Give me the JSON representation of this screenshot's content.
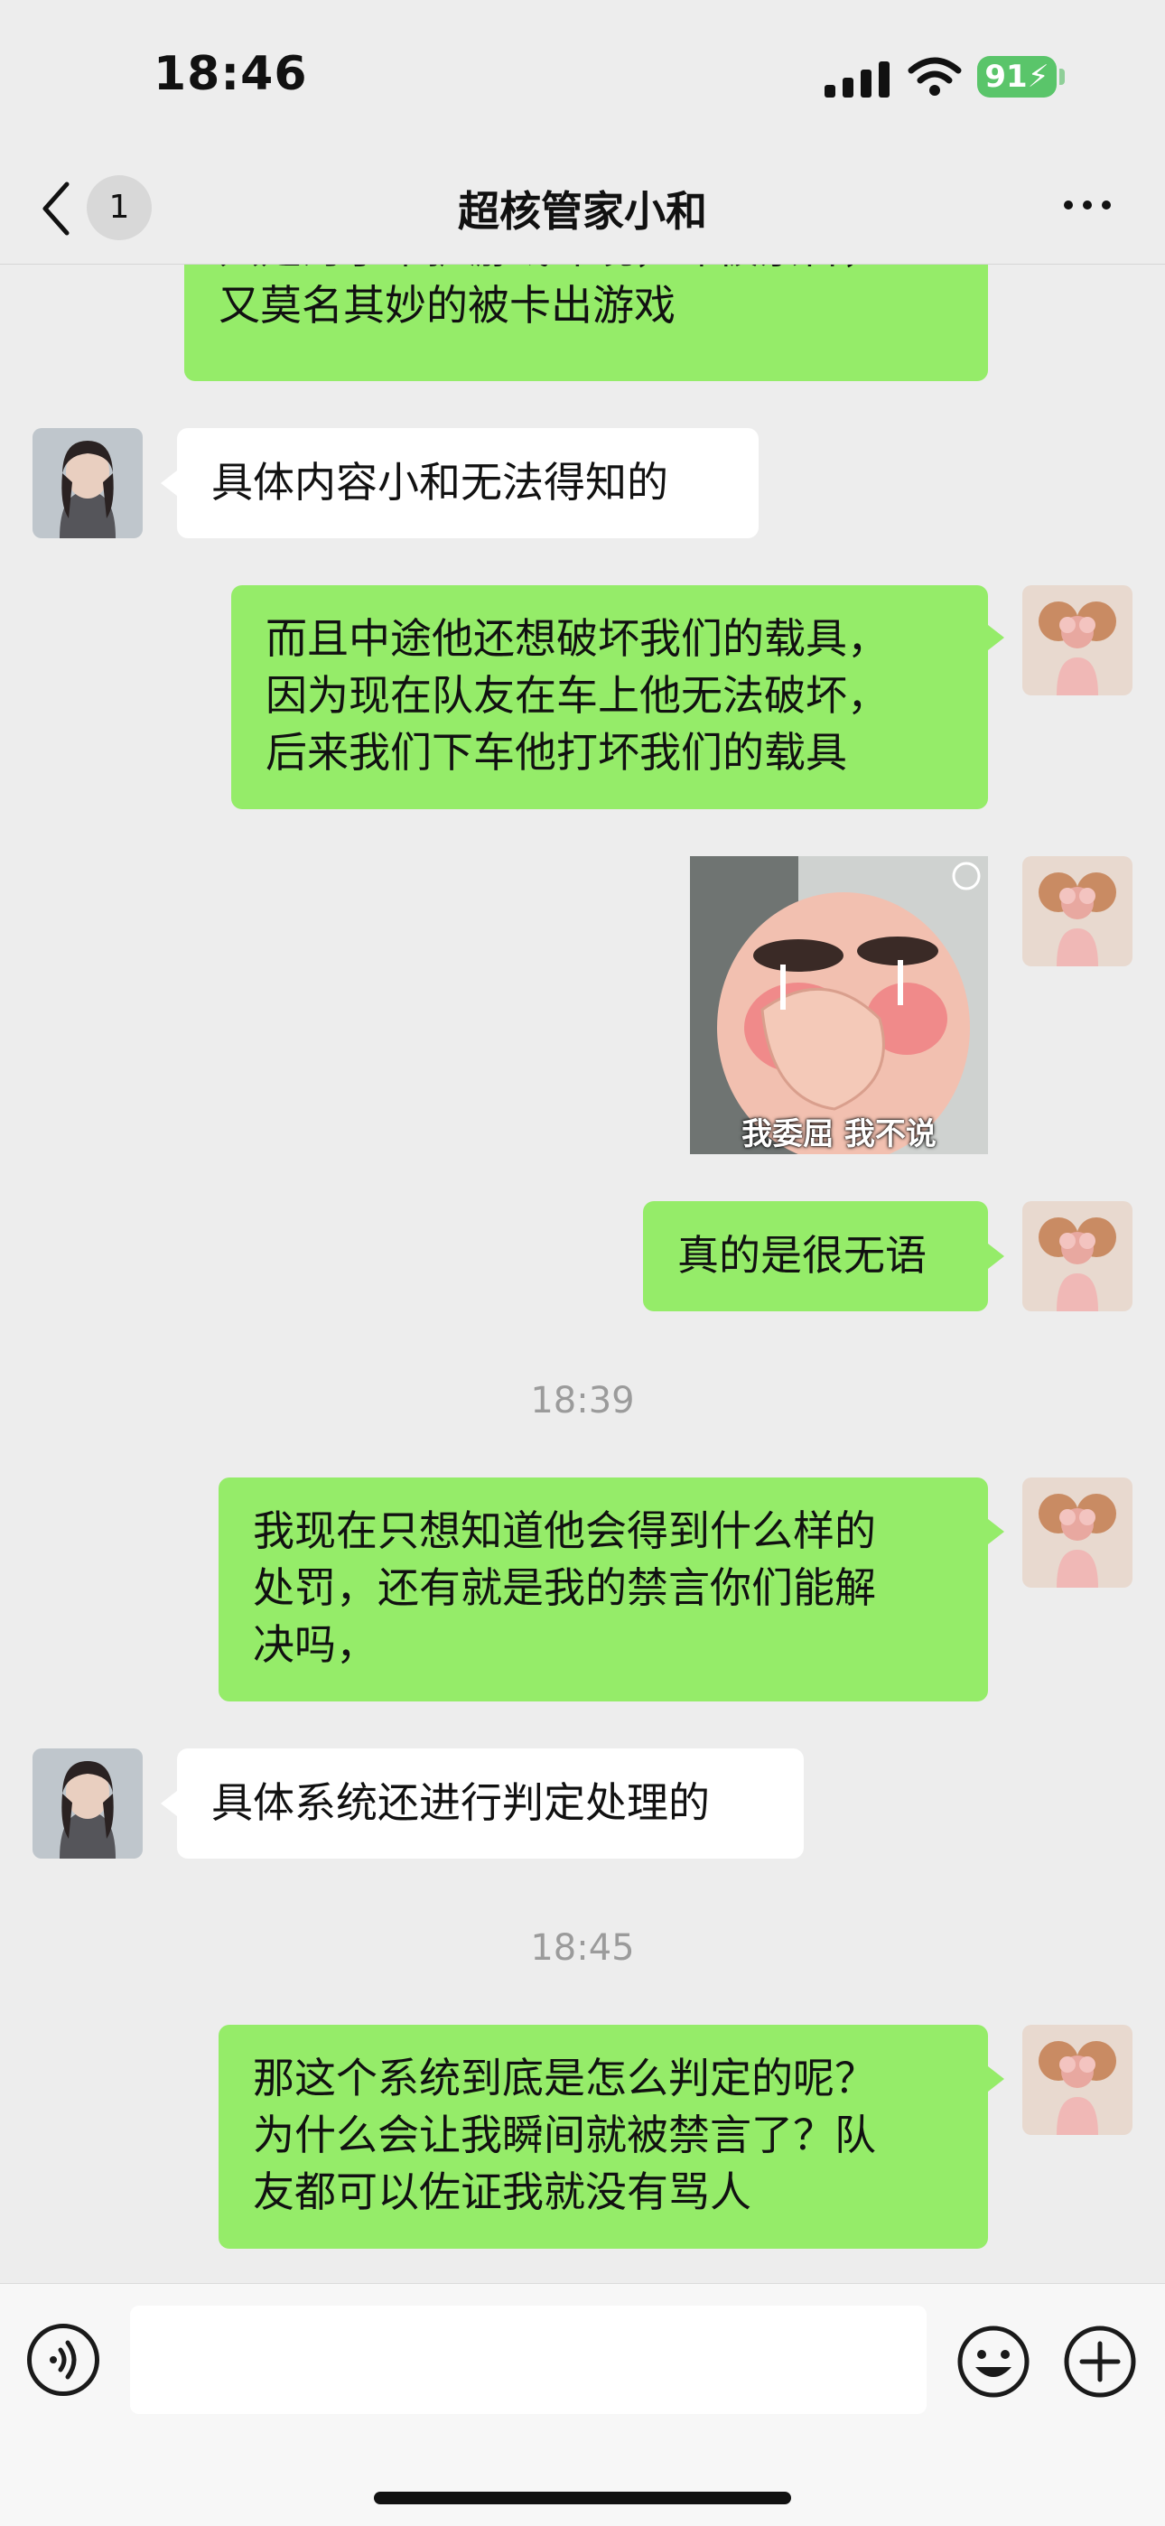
{
  "status_bar": {
    "time": "18:46",
    "battery": "91"
  },
  "nav": {
    "unread_count": "1",
    "title": "超核管家小和"
  },
  "messages": {
    "m1": {
      "text": "只是为了维护游戏环境，却被禁言，\n又莫名其妙的被卡出游戏"
    },
    "m2": {
      "text": "具体内容小和无法得知的"
    },
    "m3": {
      "text": "而且中途他还想破坏我们的载具，\n因为现在队友在车上他无法破坏，\n后来我们下车他打坏我们的载具"
    },
    "m4": {
      "sticker_caption": "我委屈 我不说"
    },
    "m5": {
      "text": "真的是很无语"
    },
    "t1": {
      "text": "18:39"
    },
    "m6": {
      "text": "我现在只想知道他会得到什么样的\n处罚，还有就是我的禁言你们能解\n决吗，"
    },
    "m7": {
      "text": "具体系统还进行判定处理的"
    },
    "t2": {
      "text": "18:45"
    },
    "m8": {
      "text": "那这个系统到底是怎么判定的呢？\n为什么会让我瞬间就被禁言了？队\n友都可以佐证我就没有骂人"
    }
  },
  "input": {
    "value": ""
  },
  "colors": {
    "sent_bubble": "#95ec69",
    "received_bubble": "#ffffff",
    "background": "#ededed",
    "battery": "#5ac56a"
  },
  "icons": [
    "back-icon",
    "more-icon",
    "voice-icon",
    "emoji-icon",
    "plus-icon",
    "signal-icon",
    "wifi-icon"
  ]
}
